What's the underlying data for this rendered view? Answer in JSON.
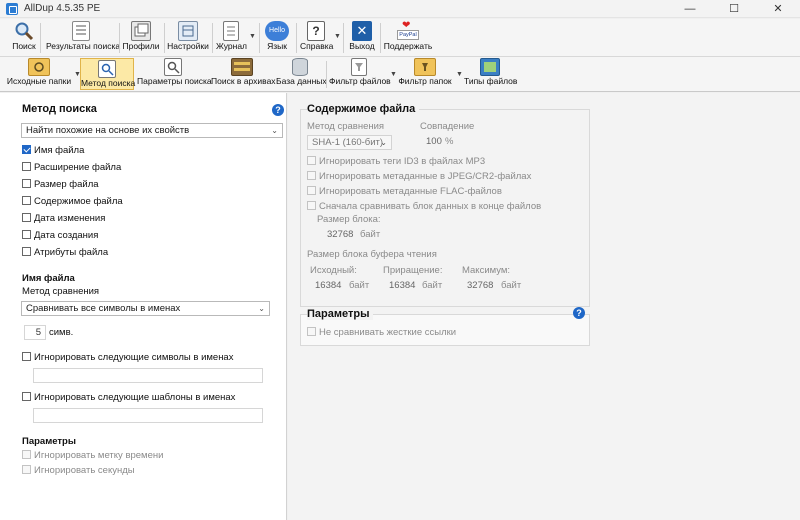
{
  "window": {
    "title": "AllDup 4.5.35 PE"
  },
  "toolbar_main": [
    {
      "label": "Поиск",
      "icon": "magnifier-icon"
    },
    {
      "label": "Результаты поиска",
      "icon": "results-list-icon"
    },
    {
      "label": "Профили",
      "icon": "profiles-icon"
    },
    {
      "label": "Настройки",
      "icon": "settings-icon"
    },
    {
      "label": "Журнал",
      "icon": "log-icon"
    },
    {
      "label": "Язык",
      "icon": "hello-bubble-icon",
      "icon_text": "Hello"
    },
    {
      "label": "Справка",
      "icon": "help-icon"
    },
    {
      "label": "Выход",
      "icon": "exit-icon"
    },
    {
      "label": "Поддержать",
      "icon": "paypal-heart-icon",
      "icon_text": "PayPal"
    }
  ],
  "toolbar_sub": [
    {
      "label": "Исходные папки",
      "icon": "source-folders-icon"
    },
    {
      "label": "Метод поиска",
      "icon": "search-method-icon",
      "selected": true
    },
    {
      "label": "Параметры поиска",
      "icon": "search-params-icon"
    },
    {
      "label": "Поиск в архивах",
      "icon": "archive-icon"
    },
    {
      "label": "База данных",
      "icon": "database-icon"
    },
    {
      "label": "Фильтр файлов",
      "icon": "file-filter-icon"
    },
    {
      "label": "Фильтр папок",
      "icon": "folder-filter-icon"
    },
    {
      "label": "Типы файлов",
      "icon": "file-types-icon"
    }
  ],
  "left": {
    "heading": "Метод поиска",
    "method_select": "Найти похожие на основе их свойств",
    "options": [
      {
        "label": "Имя файла",
        "checked": true
      },
      {
        "label": "Расширение файла",
        "checked": false
      },
      {
        "label": "Размер файла",
        "checked": false
      },
      {
        "label": "Содержимое файла",
        "checked": false
      },
      {
        "label": "Дата изменения",
        "checked": false
      },
      {
        "label": "Дата создания",
        "checked": false
      },
      {
        "label": "Атрибуты файла",
        "checked": false
      }
    ],
    "filename_heading": "Имя файла",
    "compare_label": "Метод сравнения",
    "compare_select": "Сравнивать все символы в именах",
    "chars_value": "5",
    "chars_unit": "симв.",
    "ignore_chars_label": "Игнорировать следующие символы в именах",
    "ignore_patterns_label": "Игнорировать следующие шаблоны в именах",
    "params_heading": "Параметры",
    "ignore_timestamp": "Игнорировать метку времени",
    "ignore_seconds": "Игнорировать секунды"
  },
  "content": {
    "heading": "Содержимое файла",
    "compare_method_label": "Метод сравнения",
    "compare_method_value": "SHA-1 (160-бит)",
    "match_label": "Совпадение",
    "match_value": "100",
    "match_unit": "%",
    "ignore_id3": "Игнорировать теги ID3 в файлах MP3",
    "ignore_jpeg": "Игнорировать метаданные в JPEG/CR2-файлах",
    "ignore_flac": "Игнорировать метаданные FLAC-файлов",
    "compare_end_block": "Сначала сравнивать блок данных в конце файлов",
    "block_size_label": "Размер блока:",
    "block_size_value": "32768",
    "unit_bytes": "байт",
    "buffer_label": "Размер блока буфера чтения",
    "initial_label": "Исходный:",
    "initial_value": "16384",
    "increment_label": "Приращение:",
    "increment_value": "16384",
    "max_label": "Максимум:",
    "max_value": "32768"
  },
  "params": {
    "heading": "Параметры",
    "hardlinks": "Не сравнивать жесткие ссылки"
  },
  "colors": {
    "accent": "#1f67c7",
    "selected_bg": "#fce9a6"
  }
}
